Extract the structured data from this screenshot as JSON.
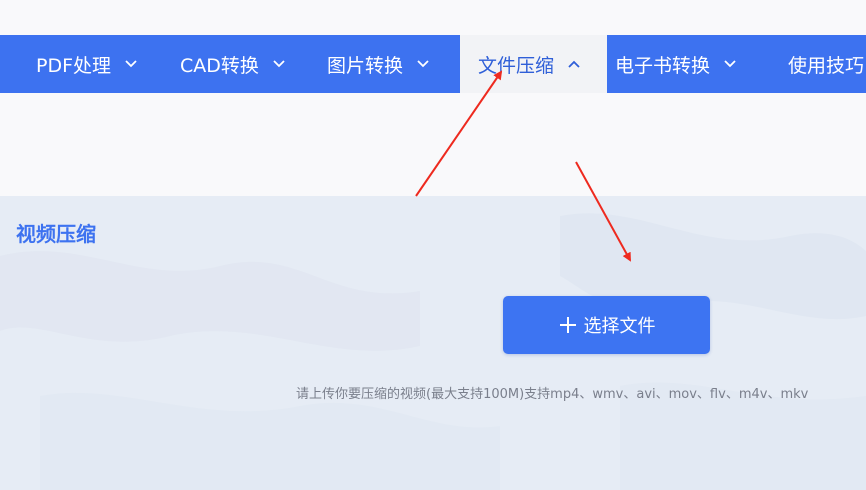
{
  "nav": {
    "items": [
      {
        "label": "PDF处理",
        "expanded": false
      },
      {
        "label": "CAD转换",
        "expanded": false
      },
      {
        "label": "图片转换",
        "expanded": false
      },
      {
        "label": "文件压缩",
        "expanded": true
      },
      {
        "label": "电子书转换",
        "expanded": false
      },
      {
        "label": "使用技巧",
        "expanded": false
      }
    ]
  },
  "main": {
    "section_title": "视频压缩",
    "select_button_label": "选择文件",
    "hint": "请上传你要压缩的视频(最大支持100M)支持mp4、wmv、avi、mov、flv、m4v、mkv"
  },
  "colors": {
    "nav_background": "#3d72f0",
    "nav_active_background": "#f2f3f6",
    "nav_active_text": "#2f5fd8",
    "content_background": "#e6ecf5",
    "accent": "#3d74f2",
    "annotation_arrow": "#ee2a1f"
  },
  "icons": {
    "nav_chevron": "chevron-down-icon",
    "nav_active_chevron": "chevron-up-icon",
    "button_icon": "plus-icon"
  }
}
